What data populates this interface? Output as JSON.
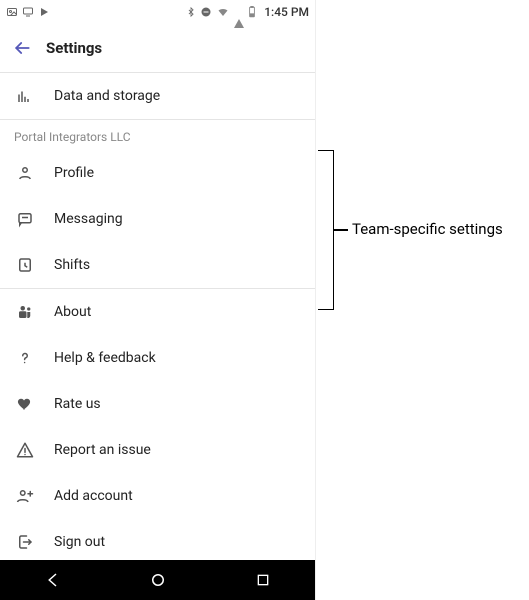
{
  "status_bar": {
    "time": "1:45 PM"
  },
  "header": {
    "title": "Settings"
  },
  "top_items": [
    {
      "icon": "histogram",
      "label": "Data and storage"
    }
  ],
  "org_section": {
    "title": "Portal Integrators LLC",
    "items": [
      {
        "icon": "profile",
        "label": "Profile"
      },
      {
        "icon": "message",
        "label": "Messaging"
      },
      {
        "icon": "shifts",
        "label": "Shifts"
      }
    ]
  },
  "app_section": [
    {
      "icon": "teams",
      "label": "About"
    },
    {
      "icon": "help",
      "label": "Help & feedback"
    },
    {
      "icon": "heart",
      "label": "Rate us"
    },
    {
      "icon": "warning",
      "label": "Report an issue"
    },
    {
      "icon": "addacct",
      "label": "Add account"
    },
    {
      "icon": "signout",
      "label": "Sign out"
    }
  ],
  "annotation": {
    "label": "Team-specific settings"
  }
}
